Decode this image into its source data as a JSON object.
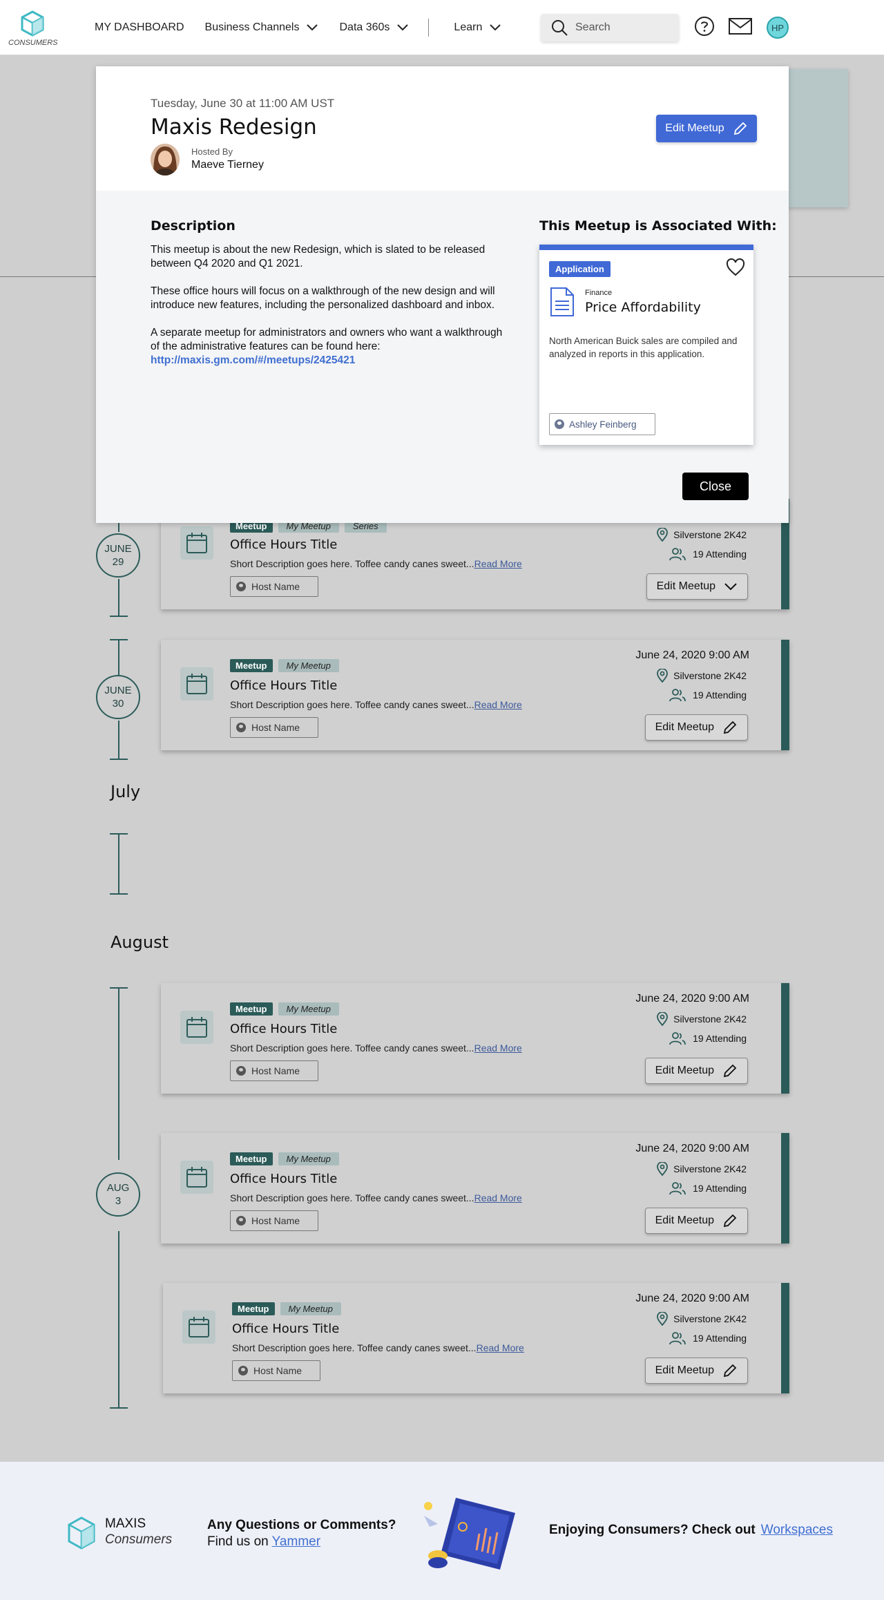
{
  "header": {
    "logo_text": "CONSUMERS",
    "nav": [
      {
        "label": "MY DASHBOARD",
        "has_chevron": false
      },
      {
        "label": "Business Channels",
        "has_chevron": true
      },
      {
        "label": "Data 360s",
        "has_chevron": true
      },
      {
        "label": "Learn",
        "has_chevron": true
      }
    ],
    "search_placeholder": "Search",
    "avatar_initials": "HP"
  },
  "modal": {
    "date": "Tuesday, June 30 at 11:00 AM UST",
    "title": "Maxis Redesign",
    "hosted_by_label": "Hosted By",
    "host_name": "Maeve Tierney",
    "edit_label": "Edit Meetup",
    "description_heading": "Description",
    "description_p1": "This meetup is about the new Redesign, which is slated to be released between Q4 2020 and Q1 2021.",
    "description_p2": "These office hours will focus on a walkthrough of the new design and will introduce new features, including the personalized dashboard and inbox.",
    "description_p3": "A separate meetup for administrators and owners who want a walkthrough of the administrative features can be found here:",
    "description_link": "http://maxis.gm.com/#/meetups/2425421",
    "assoc_heading": "This Meetup is Associated With:",
    "app_card": {
      "badge": "Application",
      "category": "Finance",
      "name": "Price Affordability",
      "description": "North American Buick sales are compiled and analyzed in reports in this application.",
      "owner": "Ashley Feinberg"
    },
    "close_label": "Close"
  },
  "timeline": {
    "months": [
      "July",
      "August"
    ],
    "dates": [
      {
        "month": "JUNE",
        "day": "29"
      },
      {
        "month": "JUNE",
        "day": "30"
      },
      {
        "month": "AUG",
        "day": "3"
      }
    ]
  },
  "events": [
    {
      "tags": [
        "Meetup",
        "My Meetup",
        "Series"
      ],
      "title": "Office Hours Title",
      "desc": "Short Description goes here. Toffee candy canes sweet...",
      "read_more": "Read More",
      "host": "Host Name",
      "location": "Silverstone 2K42",
      "attending": "19 Attending",
      "edit_label": "Edit Meetup"
    },
    {
      "tags": [
        "Meetup",
        "My Meetup"
      ],
      "date": "June 24, 2020 9:00 AM",
      "title": "Office Hours Title",
      "desc": "Short Description goes here. Toffee candy canes sweet...",
      "read_more": "Read More",
      "host": "Host Name",
      "location": "Silverstone 2K42",
      "attending": "19 Attending",
      "edit_label": "Edit Meetup"
    },
    {
      "tags": [
        "Meetup",
        "My Meetup"
      ],
      "date": "June 24, 2020 9:00 AM",
      "title": "Office Hours Title",
      "desc": "Short Description goes here. Toffee candy canes sweet...",
      "read_more": "Read More",
      "host": "Host Name",
      "location": "Silverstone 2K42",
      "attending": "19 Attending",
      "edit_label": "Edit Meetup"
    },
    {
      "tags": [
        "Meetup",
        "My Meetup"
      ],
      "date": "June 24, 2020 9:00 AM",
      "title": "Office Hours Title",
      "desc": "Short Description goes here. Toffee candy canes sweet...",
      "read_more": "Read More",
      "host": "Host Name",
      "location": "Silverstone 2K42",
      "attending": "19 Attending",
      "edit_label": "Edit Meetup"
    },
    {
      "tags": [
        "Meetup",
        "My Meetup"
      ],
      "date": "June 24, 2020 9:00 AM",
      "title": "Office Hours Title",
      "desc": "Short Description goes here. Toffee candy canes sweet...",
      "read_more": "Read More",
      "host": "Host Name",
      "location": "Silverstone 2K42",
      "attending": "19 Attending",
      "edit_label": "Edit Meetup"
    }
  ],
  "footer": {
    "brand_title": "MAXIS",
    "brand_sub": "Consumers",
    "question": "Any Questions or Comments?",
    "find_us_prefix": "Find us on",
    "find_us_link": "Yammer",
    "enjoying": "Enjoying Consumers? Check out",
    "workspaces_link": "Workspaces"
  },
  "colors": {
    "accent_blue": "#4069d6",
    "teal_dark": "#2b5b58",
    "teal_light": "#a9bcbb"
  }
}
